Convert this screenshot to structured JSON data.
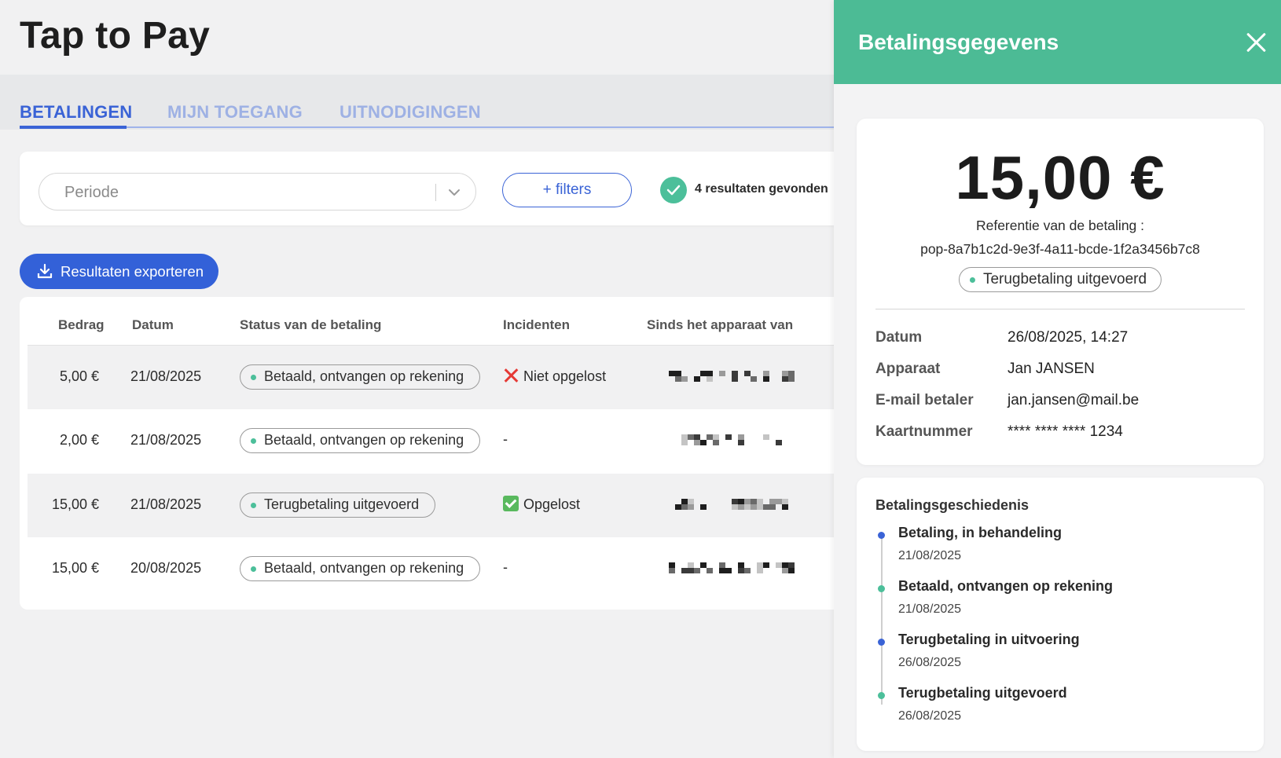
{
  "page": {
    "title": "Tap to Pay"
  },
  "tabs": [
    {
      "label": "BETALINGEN",
      "active": true
    },
    {
      "label": "MIJN TOEGANG",
      "active": false
    },
    {
      "label": "UITNODIGINGEN",
      "active": false
    }
  ],
  "filters": {
    "period_placeholder": "Periode",
    "filters_button": "+ filters",
    "results_text": "4 resultaten gevonden"
  },
  "export_button": "Resultaten exporteren",
  "table": {
    "headers": [
      "Bedrag",
      "Datum",
      "Status van de betaling",
      "Incidenten",
      "Sinds het apparaat van"
    ],
    "rows": [
      {
        "amount": "5,00 €",
        "date": "21/08/2025",
        "status": "Betaald, ontvangen op rekening",
        "incident": "Niet opgelost",
        "incident_icon": "red-cross-icon"
      },
      {
        "amount": "2,00 €",
        "date": "21/08/2025",
        "status": "Betaald, ontvangen op rekening",
        "incident": "-",
        "incident_icon": ""
      },
      {
        "amount": "15,00 €",
        "date": "21/08/2025",
        "status": "Terugbetaling uitgevoerd",
        "incident": "Opgelost",
        "incident_icon": "green-check-icon"
      },
      {
        "amount": "15,00 €",
        "date": "20/08/2025",
        "status": "Betaald, ontvangen op rekening",
        "incident": "-",
        "incident_icon": ""
      }
    ]
  },
  "drawer": {
    "title": "Betalingsgegevens",
    "amount": "15,00 €",
    "reference_label": "Referentie van de betaling :",
    "reference_value": "pop-8a7b1c2d-9e3f-4a11-bcde-1f2a3456b7c8",
    "status": "Terugbetaling uitgevoerd",
    "details": [
      {
        "label": "Datum",
        "value": "26/08/2025, 14:27"
      },
      {
        "label": "Apparaat",
        "value": "Jan JANSEN"
      },
      {
        "label": "E-mail betaler",
        "value": "jan.jansen@mail.be"
      },
      {
        "label": "Kaartnummer",
        "value": "**** **** **** 1234"
      }
    ],
    "history_title": "Betalingsgeschiedenis",
    "history": [
      {
        "title": "Betaling, in behandeling",
        "date": "21/08/2025",
        "color": "#3a63d6"
      },
      {
        "title": "Betaald, ontvangen op rekening",
        "date": "21/08/2025",
        "color": "#4cbf9a"
      },
      {
        "title": "Terugbetaling in uitvoering",
        "date": "26/08/2025",
        "color": "#3a63d6"
      },
      {
        "title": "Terugbetaling uitgevoerd",
        "date": "26/08/2025",
        "color": "#4cbf9a"
      }
    ]
  },
  "colors": {
    "accent": "#3a63d6",
    "drawer_header": "#4cbb95",
    "status_dot": "#4cbf9a"
  }
}
